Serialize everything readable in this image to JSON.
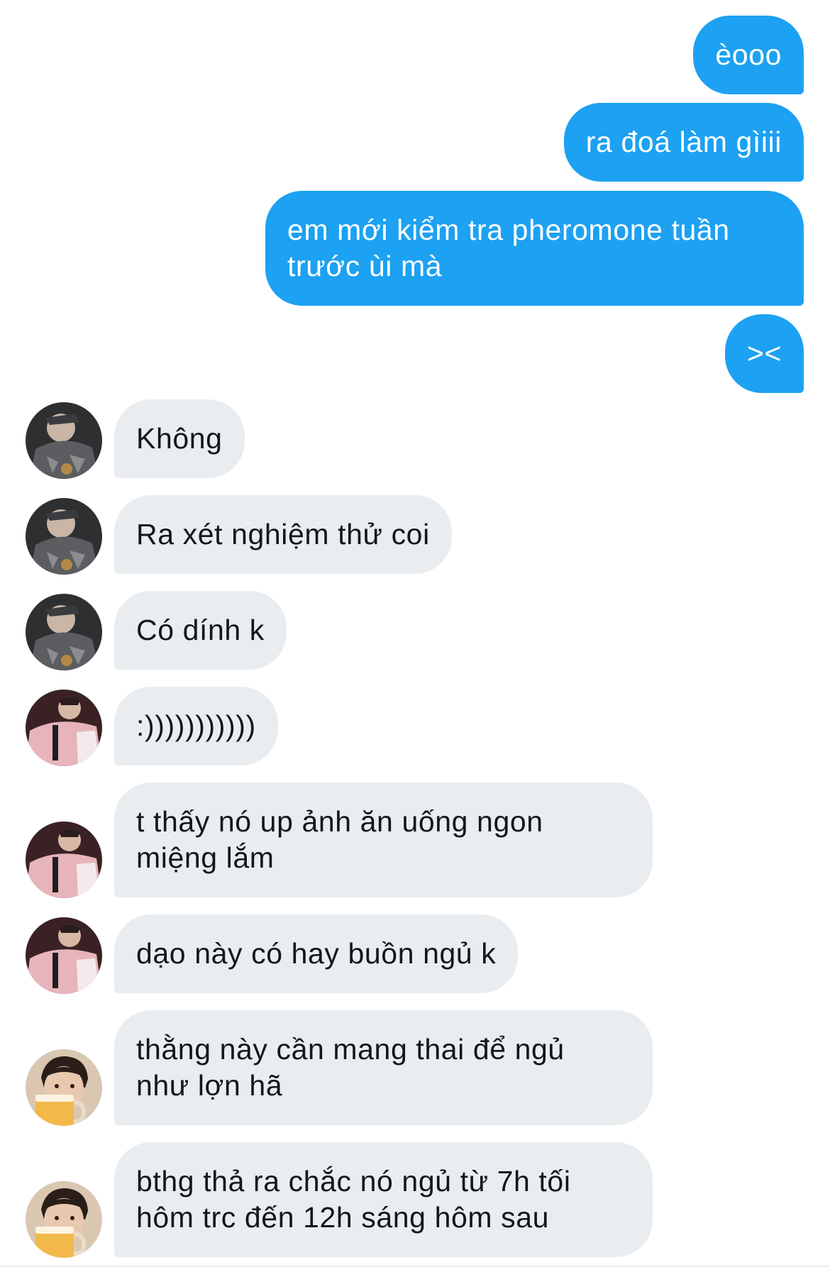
{
  "conversation": {
    "messages": [
      {
        "side": "sent",
        "text": "èooo"
      },
      {
        "side": "sent",
        "text": "ra đoá làm gìiii"
      },
      {
        "side": "sent",
        "text": "em mới kiểm tra pheromone tuần\ntrước ùi mà"
      },
      {
        "side": "sent",
        "text": "><"
      },
      {
        "side": "received",
        "avatar": "user-a",
        "text": "Không"
      },
      {
        "side": "received",
        "avatar": "user-a",
        "text": "Ra xét nghiệm thử coi"
      },
      {
        "side": "received",
        "avatar": "user-a",
        "text": "Có dính k"
      },
      {
        "side": "received",
        "avatar": "user-b",
        "text": ":)))))))))))"
      },
      {
        "side": "received",
        "avatar": "user-b",
        "text": "t thấy nó up ảnh ăn uống ngon\nmiệng lắm"
      },
      {
        "side": "received",
        "avatar": "user-b",
        "text": "dạo này có hay buồn ngủ k"
      },
      {
        "side": "received",
        "avatar": "user-c",
        "text": "thằng này cần mang thai để ngủ\nnhư lợn hã"
      },
      {
        "side": "received",
        "avatar": "user-c",
        "text": "bthg thả ra chắc nó ngủ từ 7h tối\nhôm trc đến 12h sáng hôm sau"
      }
    ]
  },
  "colors": {
    "sent_bubble": "#1da1f2",
    "received_bubble": "#e9edf0",
    "received_text": "#14171a"
  },
  "avatars": {
    "user-a": "avatar-dark-jacket",
    "user-b": "avatar-pink-jacket",
    "user-c": "avatar-beer-mug"
  }
}
